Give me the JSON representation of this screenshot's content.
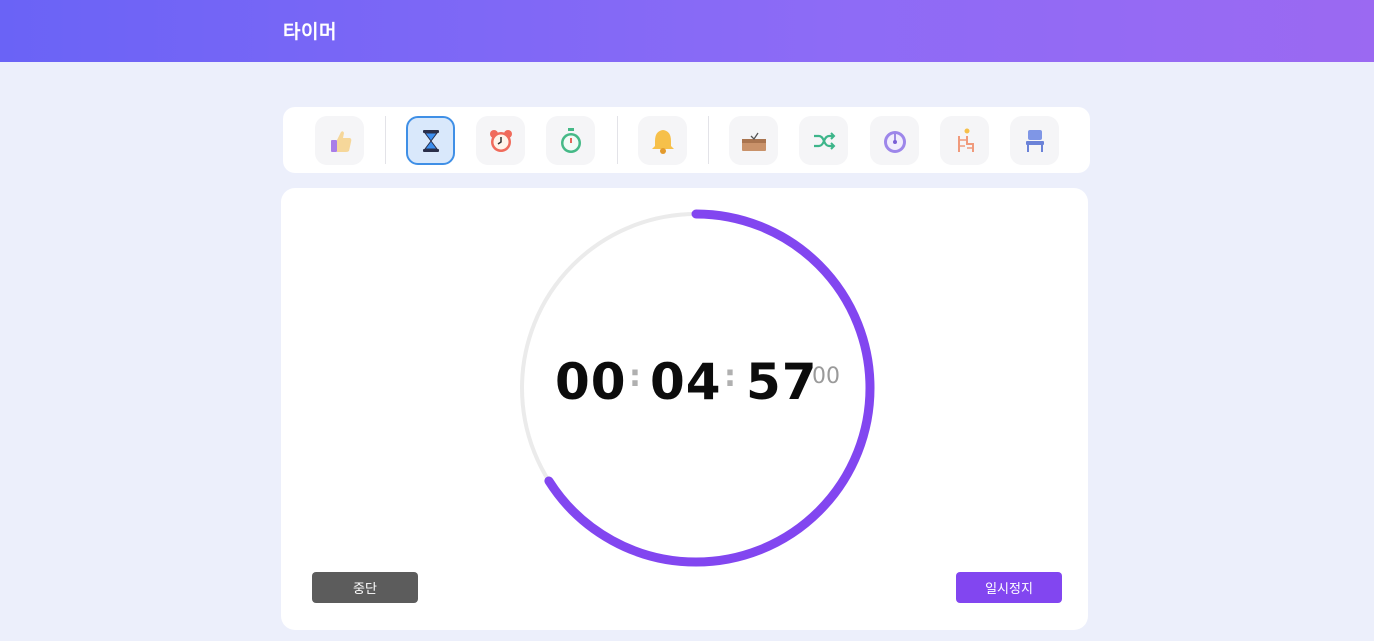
{
  "header": {
    "title": "타이머"
  },
  "toolbar": {
    "items": [
      {
        "icon": "thumbs-up-icon",
        "active": false
      },
      {
        "icon": "hourglass-icon",
        "active": true
      },
      {
        "icon": "alarm-clock-icon",
        "active": false
      },
      {
        "icon": "stopwatch-icon",
        "active": false
      },
      {
        "icon": "bell-icon",
        "active": false
      },
      {
        "icon": "box-icon",
        "active": false
      },
      {
        "icon": "shuffle-icon",
        "active": false
      },
      {
        "icon": "clock-icon",
        "active": false
      },
      {
        "icon": "ladder-icon",
        "active": false
      },
      {
        "icon": "chair-icon",
        "active": false
      }
    ]
  },
  "timer": {
    "hours": "00",
    "minutes": "04",
    "seconds": "57",
    "centiseconds": "00",
    "separator": ":",
    "progress": 0.66,
    "colors": {
      "track": "#ebebeb",
      "progress": "#8246f0"
    }
  },
  "buttons": {
    "stop_label": "중단",
    "pause_label": "일시정지"
  }
}
